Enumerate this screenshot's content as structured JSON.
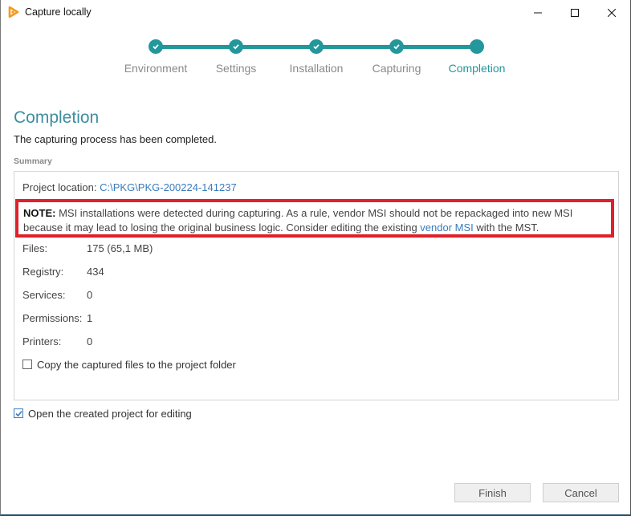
{
  "window": {
    "title": "Capture locally",
    "controls": {
      "minimize": "minimize",
      "maximize": "maximize",
      "close": "close"
    }
  },
  "stepper": {
    "accent_color": "#23979b",
    "steps": [
      {
        "label": "Environment",
        "state": "done"
      },
      {
        "label": "Settings",
        "state": "done"
      },
      {
        "label": "Installation",
        "state": "done"
      },
      {
        "label": "Capturing",
        "state": "done"
      },
      {
        "label": "Completion",
        "state": "active"
      }
    ]
  },
  "page": {
    "heading": "Completion",
    "subtext": "The capturing process has been completed.",
    "section_label": "Summary"
  },
  "summary": {
    "project_location_label": "Project location:",
    "project_location_value": "C:\\PKG\\PKG-200224-141237",
    "note": {
      "prefix": "NOTE:",
      "text_before_link": " MSI installations were detected during capturing. As a rule, vendor MSI should not be repackaged into new MSI because it may lead to losing the original business logic. Consider editing the existing ",
      "link_text": "vendor MSI",
      "text_after_link": " with the MST.",
      "highlight_color": "#e0202a"
    },
    "stats": [
      {
        "label": "Files:",
        "value": "175 (65,1 MB)"
      },
      {
        "label": "Registry:",
        "value": "434"
      },
      {
        "label": "Services:",
        "value": "0"
      },
      {
        "label": "Permissions:",
        "value": "1"
      },
      {
        "label": "Printers:",
        "value": "0"
      }
    ],
    "copy_files_option": {
      "label": "Copy the captured files to the project folder",
      "checked": false
    }
  },
  "open_project_option": {
    "label": "Open the created project for editing",
    "checked": true
  },
  "buttons": {
    "finish": "Finish",
    "cancel": "Cancel"
  }
}
